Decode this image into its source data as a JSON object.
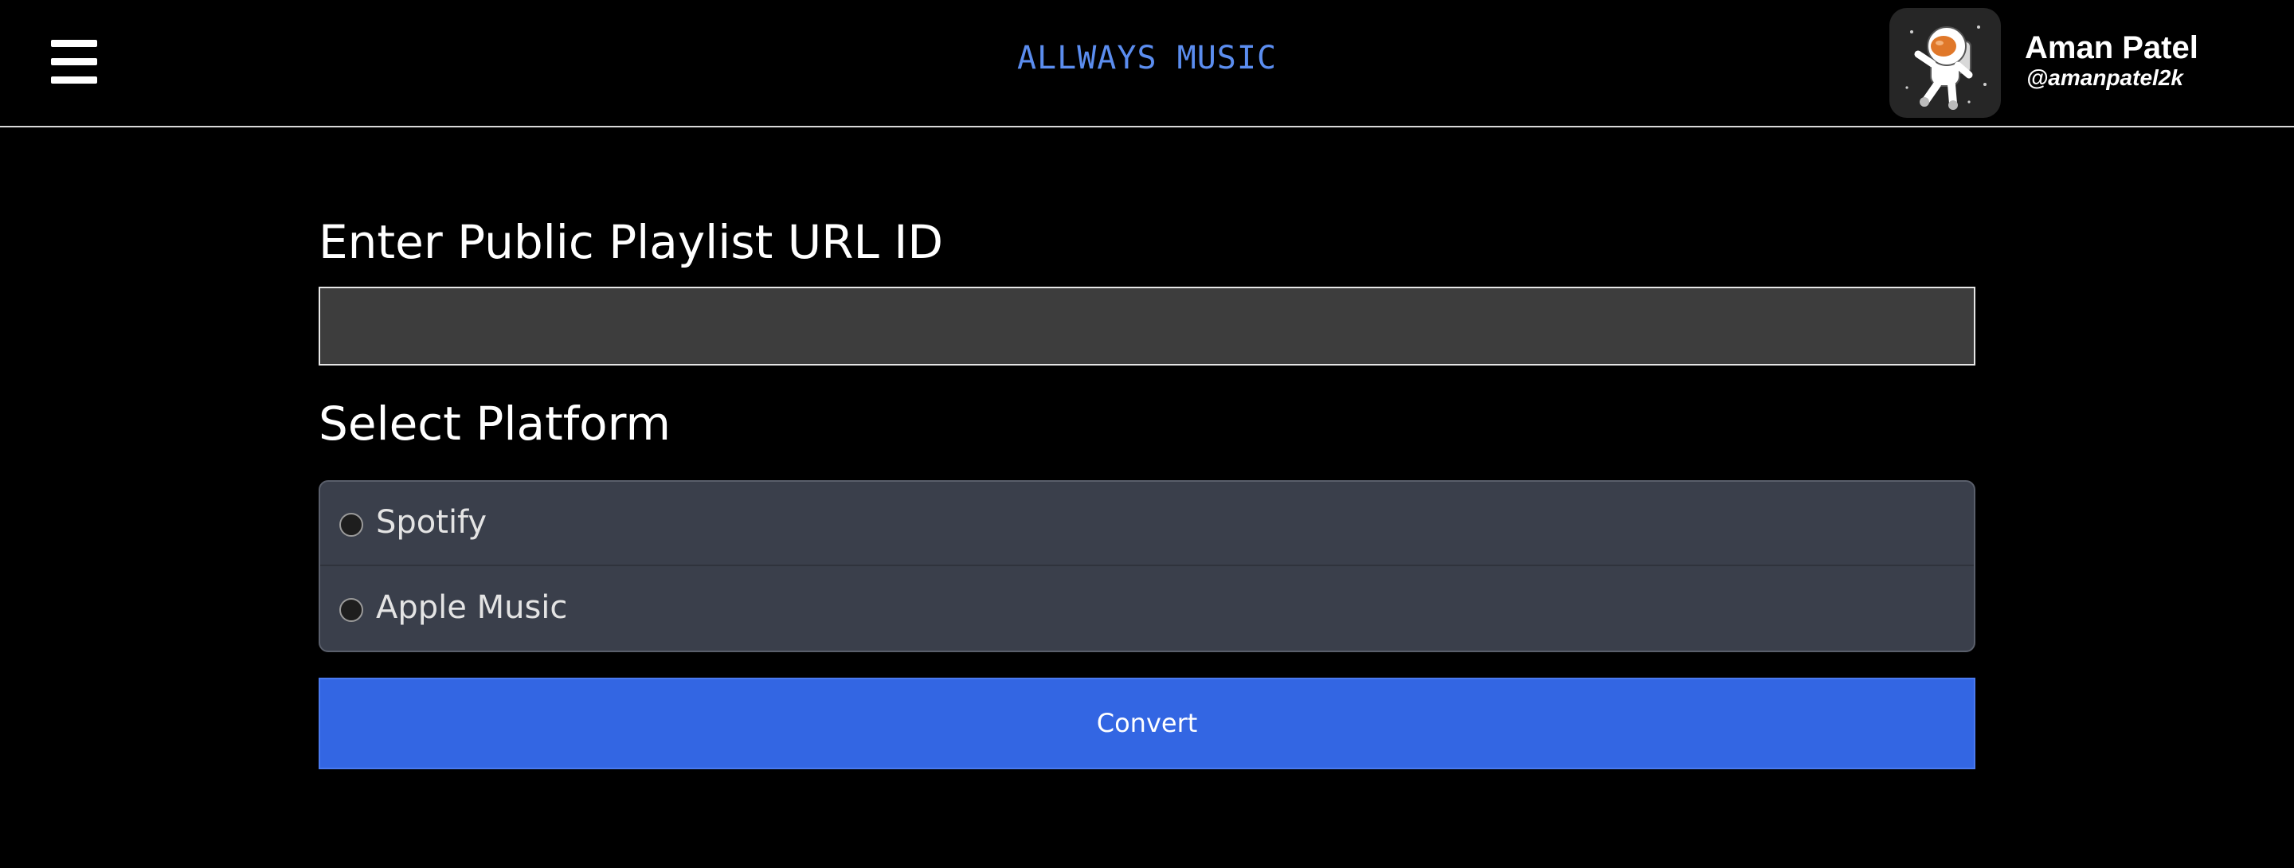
{
  "header": {
    "app_title": "ALLWAYS MUSIC",
    "menu_icon": "hamburger-menu-icon",
    "user": {
      "name": "Aman Patel",
      "handle": "@amanpatel2k",
      "avatar_icon": "astronaut-avatar-icon"
    }
  },
  "form": {
    "url_label": "Enter Public Playlist URL ID",
    "url_value": "",
    "platform_label": "Select Platform",
    "platforms": [
      {
        "label": "Spotify",
        "selected": false
      },
      {
        "label": "Apple Music",
        "selected": false
      }
    ],
    "convert_label": "Convert"
  },
  "colors": {
    "background": "#000000",
    "accent_title": "#5b8def",
    "button": "#3366e3",
    "input_bg": "#3d3d3d",
    "options_bg": "#3a3f4b"
  }
}
